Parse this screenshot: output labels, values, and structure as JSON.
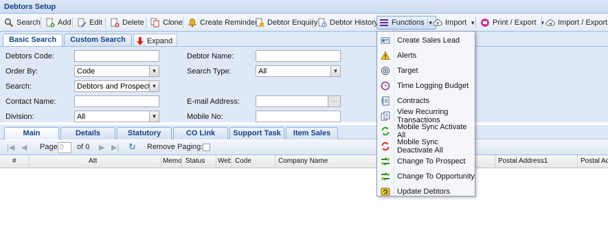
{
  "window": {
    "title": "Debtors Setup"
  },
  "toolbar": {
    "search": "Search",
    "add": "Add",
    "edit": "Edit",
    "delete": "Delete",
    "clone": "Clone",
    "create_reminder": "Create Reminder",
    "debtor_enquiry": "Debtor Enquiry",
    "debtor_history": "Debtor History",
    "functions": "Functions",
    "import": "Import",
    "print_export": "Print / Export",
    "import_export": "Import / Export"
  },
  "search_tabs": {
    "basic": "Basic Search",
    "custom": "Custom Search",
    "expand": "Expand"
  },
  "form": {
    "debtors_code_label": "Debtors Code:",
    "debtors_code_value": "",
    "debtor_name_label": "Debtor Name:",
    "debtor_name_value": "",
    "order_by_label": "Order By:",
    "order_by_value": "Code",
    "search_type_label": "Search Type:",
    "search_type_value": "All",
    "search_label": "Search:",
    "search_value": "Debtors and Prospects L",
    "contact_name_label": "Contact Name:",
    "contact_name_value": "",
    "email_label": "E-mail Address:",
    "email_value": "",
    "email_button": "···",
    "division_label": "Division:",
    "division_value": "All",
    "mobile_label": "Mobile No:",
    "mobile_value": ""
  },
  "main_tabs": [
    "Main",
    "Details",
    "Statutory",
    "CO Link",
    "Support Task",
    "Item Sales"
  ],
  "pager": {
    "page_label": "Page",
    "page_value": "0",
    "of_label": "of 0",
    "remove_paging": "Remove Paging:"
  },
  "grid": {
    "columns": [
      "#",
      "Att",
      "Memo",
      "Status",
      "Web",
      "Code",
      "Company Name",
      "Postal Address1",
      "Postal Addr"
    ]
  },
  "functions_menu": {
    "items": [
      {
        "label": "Create Sales Lead",
        "icon": "sales-lead-card-icon"
      },
      {
        "label": "Alerts",
        "icon": "alert-warning-icon"
      },
      {
        "label": "Target",
        "icon": "target-icon"
      },
      {
        "label": "Time Logging Budget",
        "icon": "time-budget-icon"
      },
      {
        "label": "Contracts",
        "icon": "contract-document-icon"
      },
      {
        "label": "View Recurring Transactions",
        "icon": "recurring-transactions-icon"
      },
      {
        "label": "Mobile Sync Activate All",
        "icon": "sync-activate-icon"
      },
      {
        "label": "Mobile Sync Deactivate All",
        "icon": "sync-deactivate-icon"
      },
      {
        "label": "Change To Prospect",
        "icon": "change-prospect-icon"
      },
      {
        "label": "Change To Opportunity",
        "icon": "change-opportunity-icon"
      },
      {
        "label": "Update Debtors",
        "icon": "update-debtors-icon"
      }
    ]
  },
  "colors": {
    "header_blue": "#15428b",
    "panel_bg": "#dfe8f6",
    "border_blue": "#99bbe8"
  }
}
